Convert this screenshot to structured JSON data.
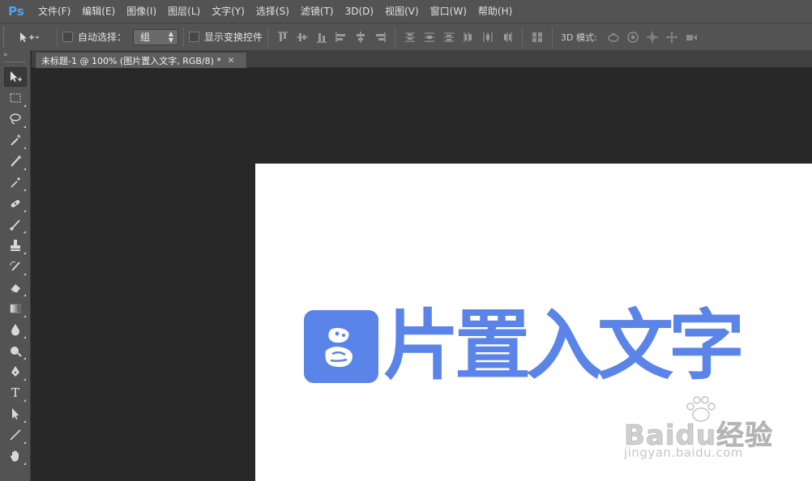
{
  "app": {
    "logo": "Ps"
  },
  "menu": [
    "文件(F)",
    "编辑(E)",
    "图像(I)",
    "图层(L)",
    "文字(Y)",
    "选择(S)",
    "滤镜(T)",
    "3D(D)",
    "视图(V)",
    "窗口(W)",
    "帮助(H)"
  ],
  "options": {
    "auto_select_label": "自动选择：",
    "auto_select_value": "组",
    "show_transform_label": "显示变换控件",
    "mode_label": "3D 模式:"
  },
  "toolbar": {
    "collapse": "»",
    "tools": [
      "move-tool",
      "rectangular-marquee-tool",
      "lasso-tool",
      "magic-wand-tool",
      "crop-tool",
      "eyedropper-tool",
      "spot-healing-tool",
      "brush-tool",
      "clone-stamp-tool",
      "history-brush-tool",
      "eraser-tool",
      "gradient-tool",
      "blur-tool",
      "dodge-tool",
      "pen-tool",
      "type-tool",
      "path-selection-tool",
      "line-tool",
      "hand-tool"
    ],
    "type_glyph": "T"
  },
  "document": {
    "tab_label": "未标题-1 @ 100% (图片置入文字, RGB/8) *",
    "close": "×"
  },
  "canvas": {
    "headline": "片置入文字",
    "accent_color": "#5b84e8"
  },
  "watermark": {
    "main": "Baidu经验",
    "sub": "jingyan.baidu.com"
  }
}
